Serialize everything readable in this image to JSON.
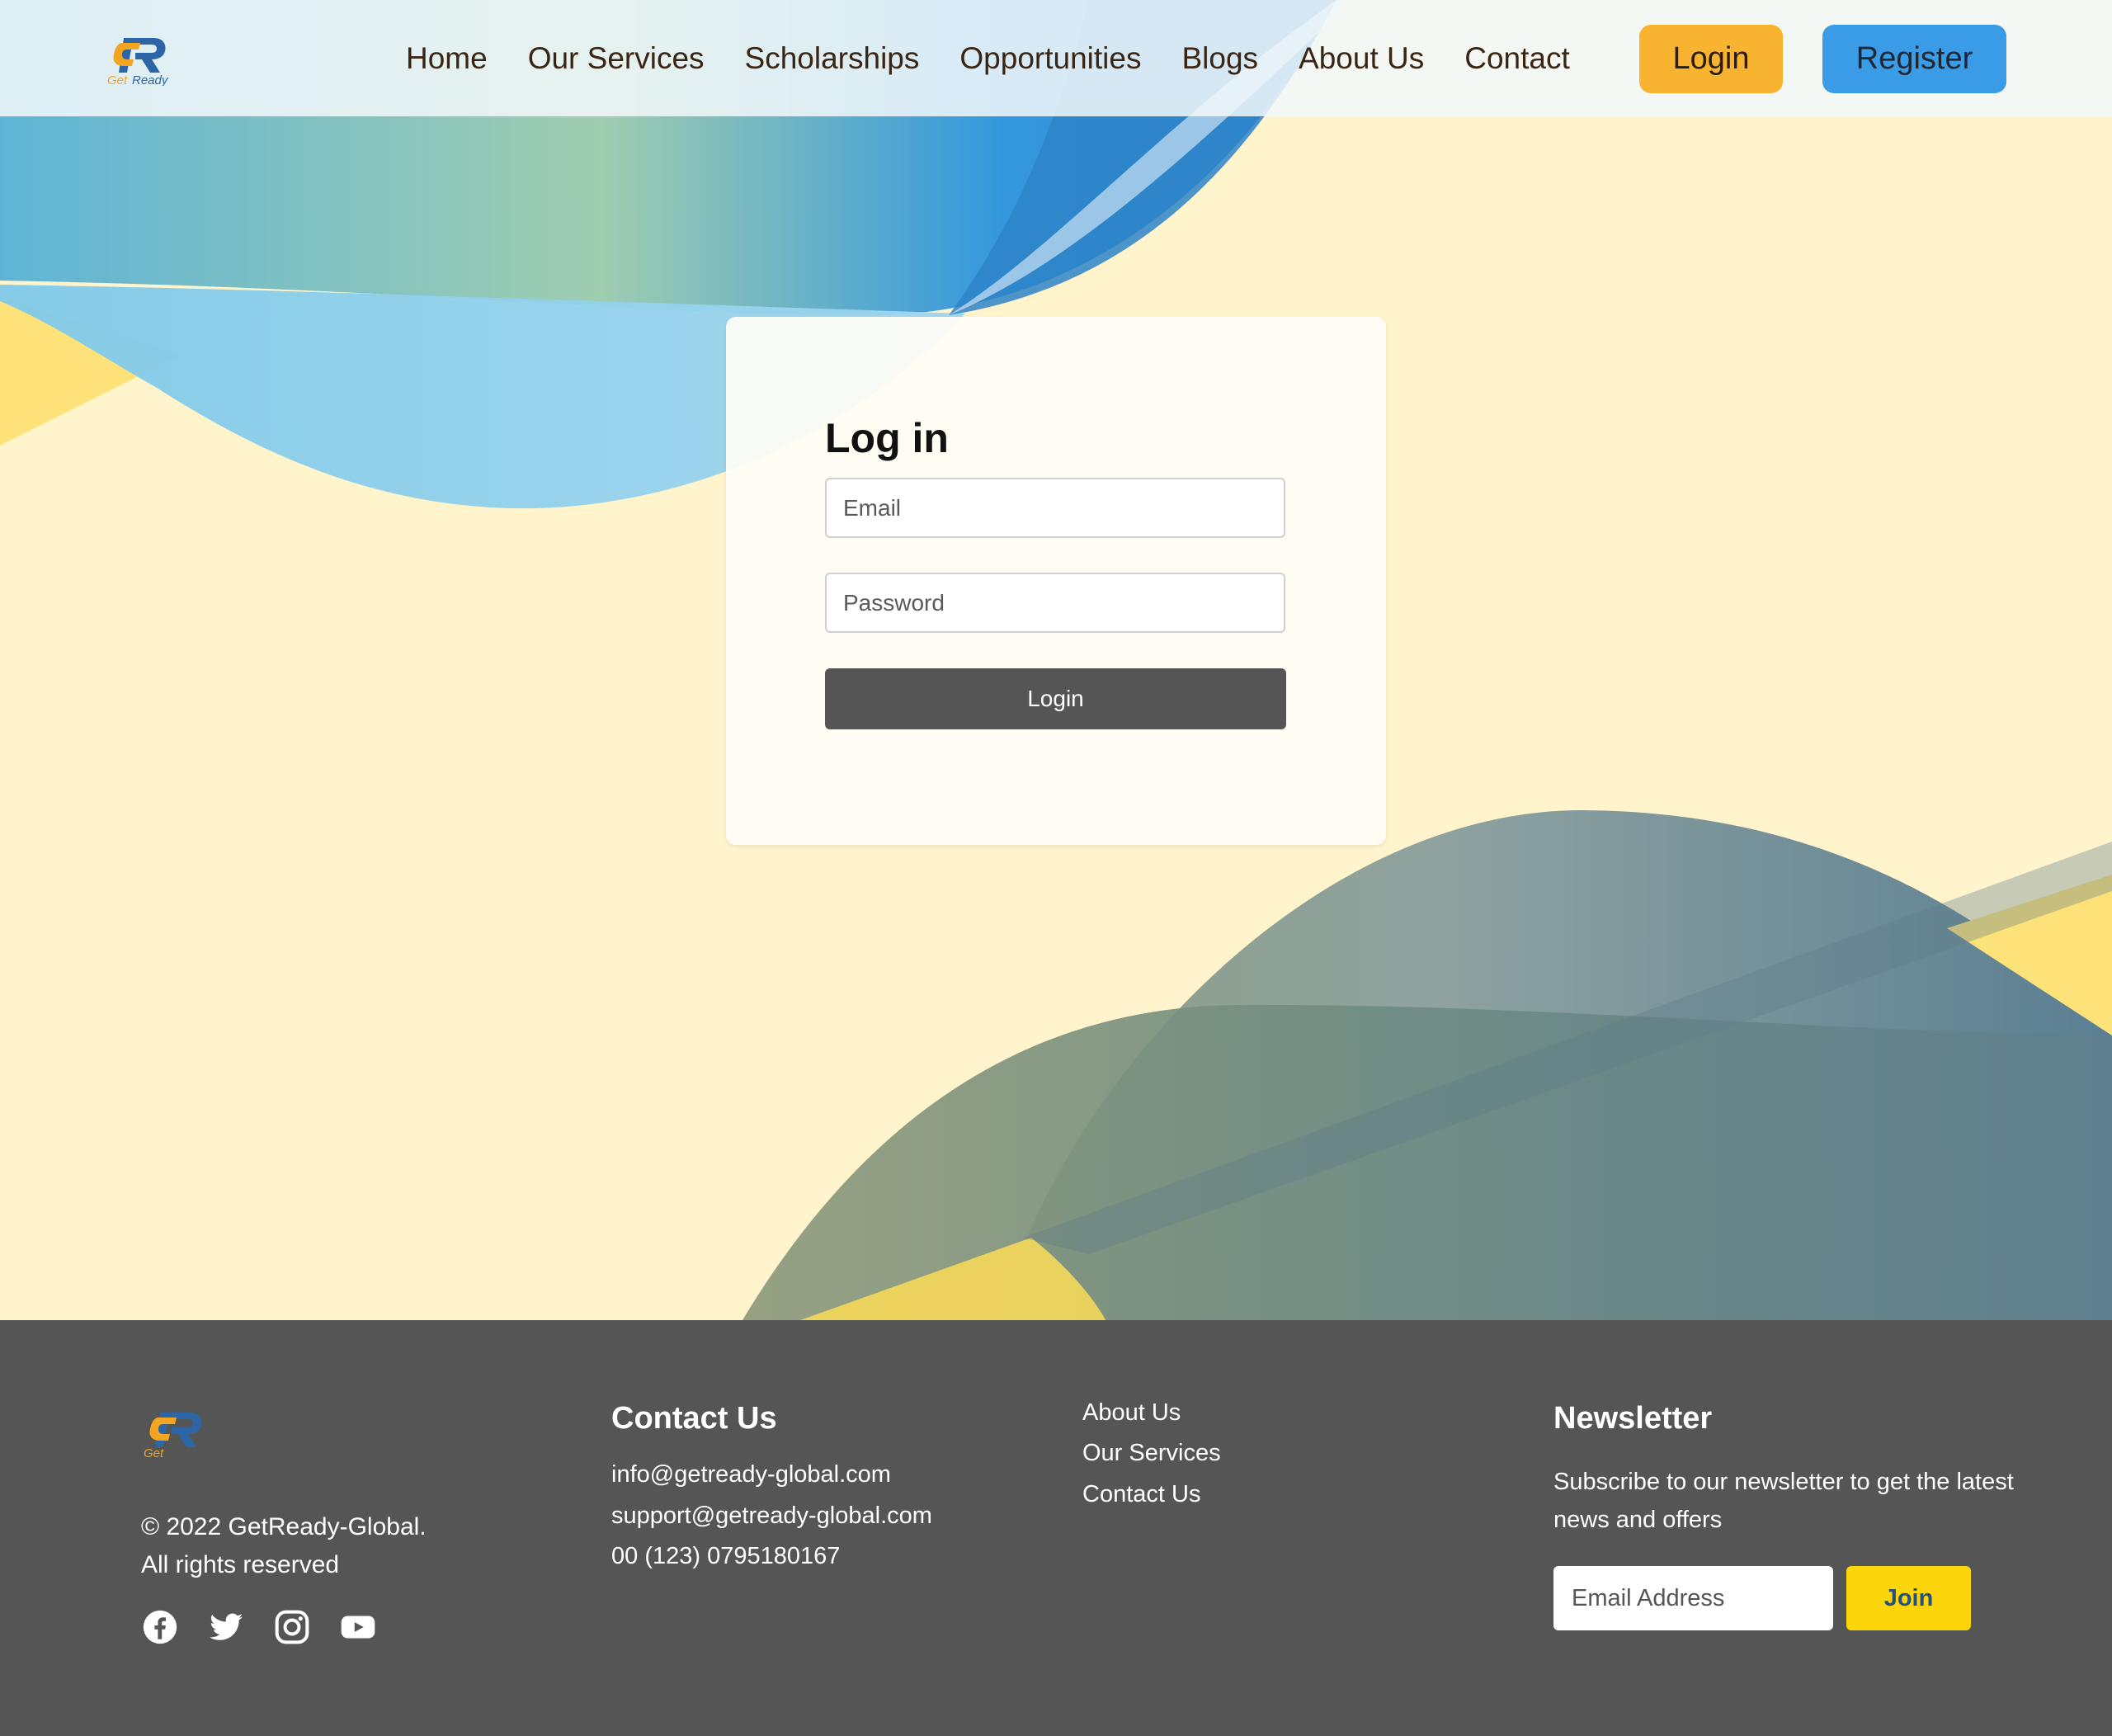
{
  "header": {
    "logo_icon": "getready-logo",
    "logo_text": "GetReady",
    "nav": [
      {
        "label": "Home"
      },
      {
        "label": "Our Services"
      },
      {
        "label": "Scholarships"
      },
      {
        "label": "Opportunities"
      },
      {
        "label": "Blogs"
      },
      {
        "label": "About Us"
      },
      {
        "label": "Contact"
      }
    ],
    "login_label": "Login",
    "register_label": "Register",
    "colors": {
      "login_button": "#f8b431",
      "register_button": "#3a9be6"
    }
  },
  "login_form": {
    "title": "Log in",
    "email_placeholder": "Email",
    "password_placeholder": "Password",
    "submit_label": "Login",
    "colors": {
      "submit_button": "#555555"
    }
  },
  "footer": {
    "logo_icon": "getready-logo",
    "logo_text": "Get",
    "copyright_line1": "© 2022 GetReady-Global.",
    "copyright_line2": "All rights reserved",
    "socials": [
      {
        "icon": "facebook-icon"
      },
      {
        "icon": "twitter-icon"
      },
      {
        "icon": "instagram-icon"
      },
      {
        "icon": "youtube-icon"
      }
    ],
    "contact": {
      "heading": "Contact Us",
      "lines": [
        "info@getready-global.com",
        "support@getready-global.com",
        "00 (123) 0795180167"
      ]
    },
    "links": [
      "About Us",
      "Our Services",
      "Contact Us"
    ],
    "newsletter": {
      "heading": "Newsletter",
      "text": "Subscribe to our newsletter to get the latest news and offers",
      "email_placeholder": "Email Address",
      "join_label": "Join"
    },
    "colors": {
      "background": "#555555",
      "join_button": "#fcd60b"
    }
  }
}
